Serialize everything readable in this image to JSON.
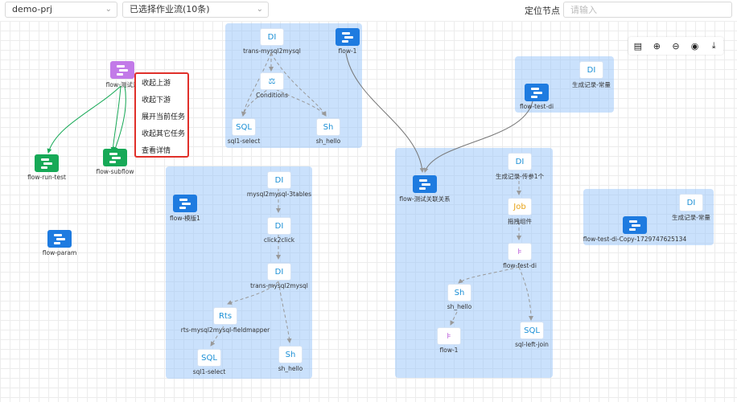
{
  "toolbar": {
    "project_select": "demo-prj",
    "flow_select": "已选择作业流(10条)",
    "locate_label": "定位节点",
    "locate_placeholder": "请输入"
  },
  "context_menu": [
    "收起上游",
    "收起下游",
    "展开当前任务",
    "收起其它任务",
    "查看详情"
  ],
  "zoom_tools": [
    "fit-view-icon",
    "zoom-in-icon",
    "zoom-out-icon",
    "locate-icon",
    "download-icon"
  ],
  "groups": {
    "trans": {
      "nodes": {
        "di": "DI",
        "di_label": "trans-mysql2mysql",
        "flow1": "flow-1",
        "cond": "Conditions",
        "sql": "SQL",
        "sql_label": "sql1-select",
        "sh": "Sh",
        "sh_label": "sh_hello"
      }
    },
    "moban": {
      "nodes": {
        "flow": "flow-模版1",
        "di1": "DI",
        "di1_label": "mysql2mysql-3tables",
        "di2": "DI",
        "di2_label": "click2click",
        "di3": "DI",
        "di3_label": "trans-mysql2mysql",
        "rts": "Rts",
        "rts_label": "rts-mysql2mysql-fieldmapper",
        "sql": "SQL",
        "sql_label": "sql1-select",
        "sh": "Sh",
        "sh_label": "sh_hello"
      }
    },
    "testdi": {
      "nodes": {
        "di": "DI",
        "di_label": "生成记录-常量",
        "flow": "flow-test-di"
      }
    },
    "guanlian": {
      "nodes": {
        "flow": "flow-测试关联关系",
        "di": "DI",
        "di_label": "生成记录-传参1个",
        "job": "Job",
        "job_label": "拖拽组件",
        "fest": "flow-fest-di",
        "sh": "Sh",
        "sh_label": "sh_hello",
        "sql": "SQL",
        "sql_label": "sql-left-join",
        "flow1": "flow-1"
      }
    },
    "copy": {
      "nodes": {
        "di": "DI",
        "di_label": "生成记录-常量",
        "flow": "flow-test-di-Copy-1729747625134"
      }
    }
  },
  "free_nodes": {
    "ceshi": "flow-测试流",
    "run_test": "flow-run-test",
    "subflow": "flow-subflow",
    "param": "flow-param"
  },
  "colors": {
    "accent": "#1e7be0",
    "group_fill": "#9ec8fa",
    "menu_border": "#e0302a",
    "green": "#17a957",
    "purple": "#c27ae8"
  }
}
